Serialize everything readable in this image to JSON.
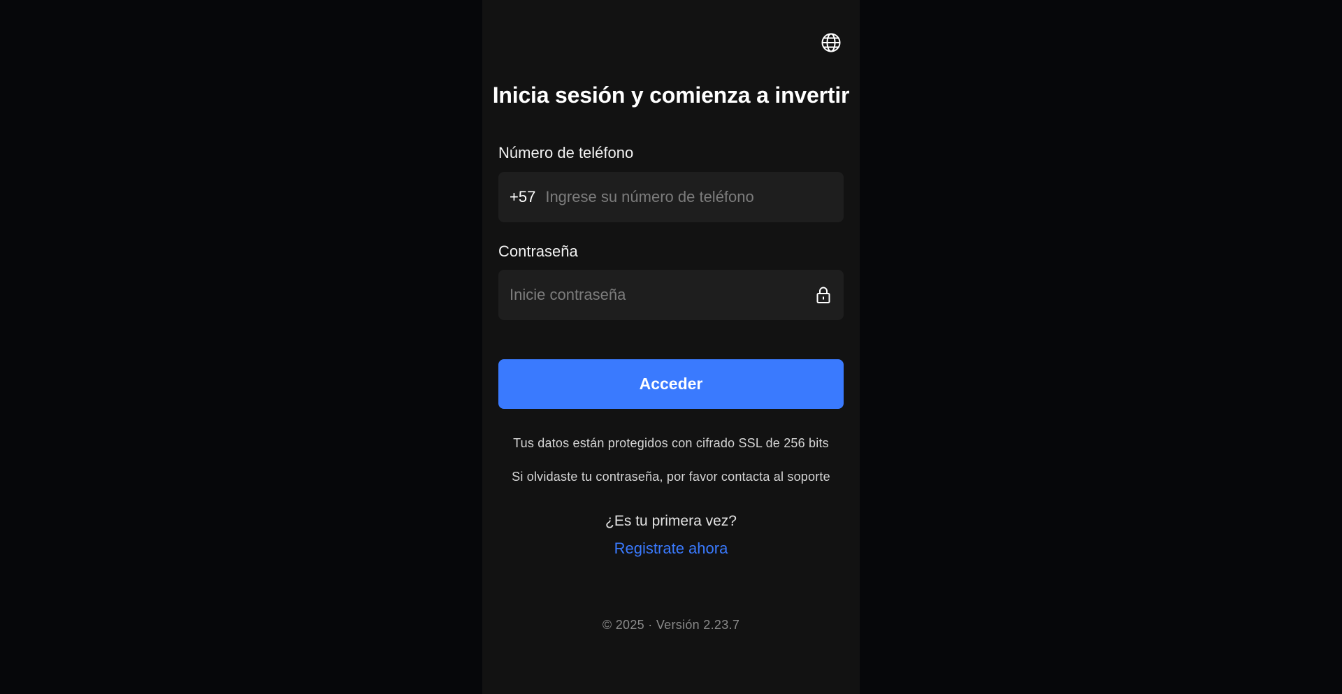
{
  "header": {
    "language_icon": "globe-icon",
    "title": "Inicia sesión y comienza a invertir"
  },
  "form": {
    "phone": {
      "label": "Número de teléfono",
      "prefix": "+57",
      "placeholder": "Ingrese su número de teléfono",
      "value": ""
    },
    "password": {
      "label": "Contraseña",
      "placeholder": "Inicie contraseña",
      "value": "",
      "toggle_icon": "lock-icon"
    },
    "submit_label": "Acceder"
  },
  "notes": {
    "ssl": "Tus datos están protegidos con cifrado SSL de 256 bits",
    "forgot": "Si olvidaste tu contraseña, por favor contacta al soporte"
  },
  "signup": {
    "question": "¿Es tu primera vez?",
    "link_label": "Registrate ahora"
  },
  "footer": {
    "text": "© 2025 · Versión 2.23.7"
  },
  "colors": {
    "background": "#06070a",
    "panel": "#121212",
    "input": "#1e1e1e",
    "accent": "#3a7afe"
  }
}
